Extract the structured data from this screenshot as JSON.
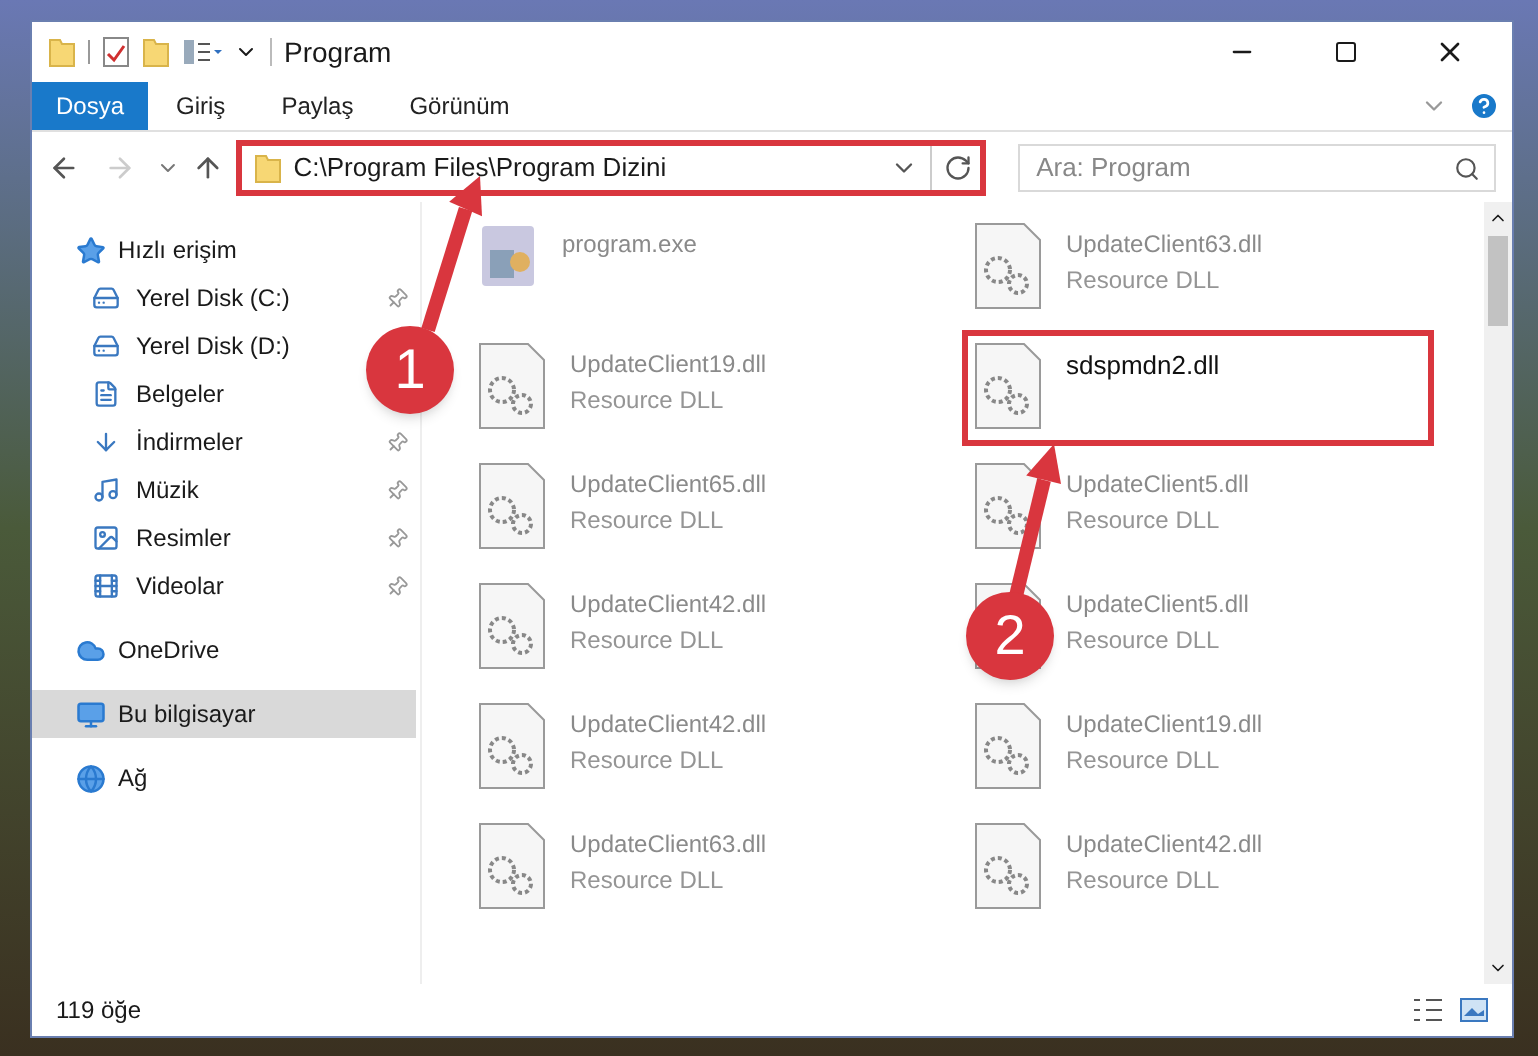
{
  "window": {
    "title": "Program"
  },
  "ribbon_tabs": [
    {
      "label": "Dosya",
      "selected": true
    },
    {
      "label": "Giriş",
      "selected": false
    },
    {
      "label": "Paylaş",
      "selected": false
    },
    {
      "label": "Görünüm",
      "selected": false
    }
  ],
  "address_bar": {
    "path": "C:\\Program Files\\Program Dizini",
    "highlighted": true
  },
  "search": {
    "placeholder": "Ara: Program"
  },
  "sidebar": {
    "items": [
      {
        "label": "Hızlı erişim",
        "selected": false,
        "children": [
          {
            "label": "Yerel Disk (C:)",
            "pinned": true
          },
          {
            "label": "Yerel Disk (D:)",
            "pinned": false
          },
          {
            "label": "Belgeler",
            "pinned": false
          },
          {
            "label": "İndirmeler",
            "pinned": true
          },
          {
            "label": "Müzik",
            "pinned": true
          },
          {
            "label": "Resimler",
            "pinned": true
          },
          {
            "label": "Videolar",
            "pinned": true
          }
        ]
      },
      {
        "label": "OneDrive",
        "selected": false
      },
      {
        "label": "Bu bilgisayar",
        "selected": true
      },
      {
        "label": "Ağ",
        "selected": false
      }
    ]
  },
  "files": [
    {
      "name": "program.exe",
      "kind": "exe",
      "highlighted": false
    },
    {
      "name": "UpdateClient63.dll",
      "type": "Resource DLL",
      "kind": "dll",
      "highlighted": false
    },
    {
      "name": "UpdateClient19.dll",
      "type": "Resource DLL",
      "kind": "dll",
      "highlighted": false
    },
    {
      "name": "sdspmdn2.dll",
      "kind": "dll",
      "highlighted": true
    },
    {
      "name": "UpdateClient65.dll",
      "type": "Resource DLL",
      "kind": "dll",
      "highlighted": false
    },
    {
      "name": "UpdateClient5.dll",
      "type": "Resource DLL",
      "kind": "dll",
      "highlighted": false
    },
    {
      "name": "UpdateClient42.dll",
      "type": "Resource DLL",
      "kind": "dll",
      "highlighted": false
    },
    {
      "name": "UpdateClient5.dll",
      "type": "Resource DLL",
      "kind": "dll",
      "highlighted": false
    },
    {
      "name": "UpdateClient42.dll",
      "type": "Resource DLL",
      "kind": "dll",
      "highlighted": false
    },
    {
      "name": "UpdateClient19.dll",
      "type": "Resource DLL",
      "kind": "dll",
      "highlighted": false
    },
    {
      "name": "UpdateClient63.dll",
      "type": "Resource DLL",
      "kind": "dll",
      "highlighted": false
    },
    {
      "name": "UpdateClient42.dll",
      "type": "Resource DLL",
      "kind": "dll",
      "highlighted": false
    }
  ],
  "status_bar": {
    "count": "119 öğe"
  },
  "callouts": [
    {
      "label": "1"
    },
    {
      "label": "2"
    }
  ]
}
